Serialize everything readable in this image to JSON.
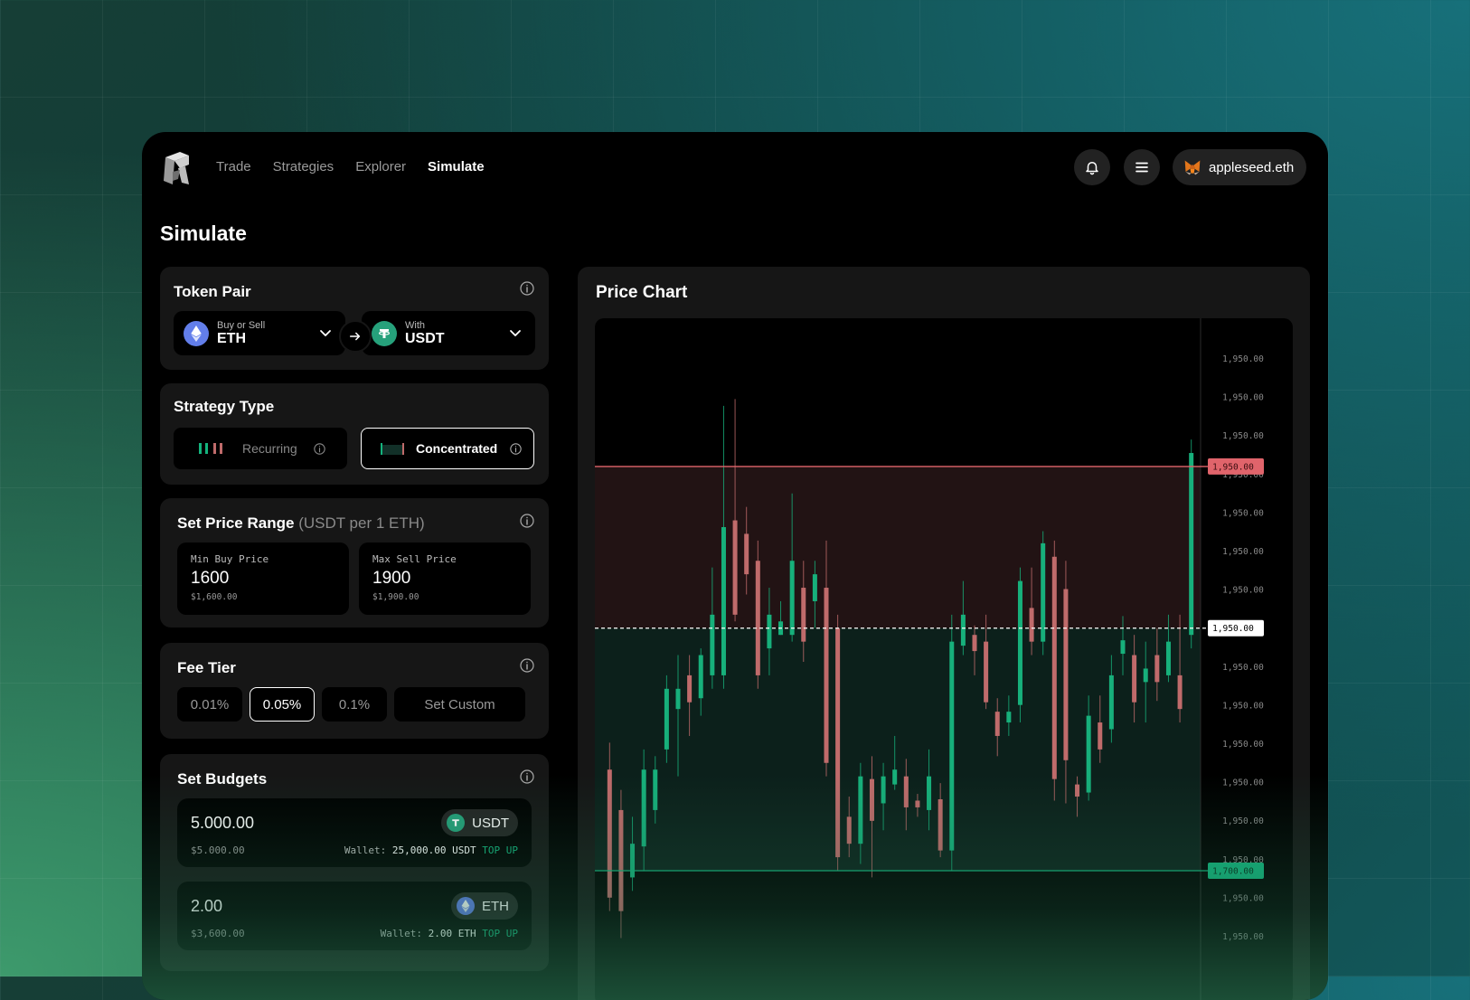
{
  "nav": {
    "items": [
      "Trade",
      "Strategies",
      "Explorer",
      "Simulate"
    ],
    "active": "Simulate"
  },
  "wallet": {
    "name": "appleseed.eth"
  },
  "page_title": "Simulate",
  "token_pair": {
    "title": "Token Pair",
    "base": {
      "label": "Buy or Sell",
      "symbol": "ETH"
    },
    "quote": {
      "label": "With",
      "symbol": "USDT"
    }
  },
  "strategy_type": {
    "title": "Strategy Type",
    "options": [
      "Recurring",
      "Concentrated"
    ],
    "selected": "Concentrated"
  },
  "price_range": {
    "title": "Set Price Range",
    "unit": "(USDT per 1 ETH)",
    "min": {
      "label": "Min Buy Price",
      "value": "1600",
      "usd": "$1,600.00"
    },
    "max": {
      "label": "Max Sell Price",
      "value": "1900",
      "usd": "$1,900.00"
    }
  },
  "fee_tier": {
    "title": "Fee Tier",
    "options": [
      "0.01%",
      "0.05%",
      "0.1%",
      "Set Custom"
    ],
    "selected": "0.05%"
  },
  "budgets": {
    "title": "Set Budgets",
    "items": [
      {
        "amount": "5.000.00",
        "usd": "$5.000.00",
        "token": "USDT",
        "wallet_label": "Wallet:",
        "wallet_value": "25,000.00 USDT",
        "action": "TOP UP"
      },
      {
        "amount": "2.00",
        "usd": "$3,600.00",
        "token": "ETH",
        "wallet_label": "Wallet:",
        "wallet_value": "2.00 ETH",
        "action": "TOP UP"
      }
    ]
  },
  "chart_data": {
    "type": "candlestick",
    "title": "Price Chart",
    "y_tick_labels": [
      "1,950.00",
      "1,950.00",
      "1,950.00",
      "1,950.00",
      "1,950.00",
      "1,950.00",
      "1,950.00",
      "1,950.00",
      "1,950.00",
      "1,950.00",
      "1,950.00",
      "1,950.00",
      "1,950.00",
      "1,950.00",
      "1,950.00",
      "1,950.00"
    ],
    "ylim": [
      1500,
      2010
    ],
    "sell_line": {
      "label": "1,950.00",
      "value": 1900
    },
    "current_line": {
      "label": "1,950.00",
      "value": 1780
    },
    "buy_line": {
      "label": "1,700.00",
      "value": 1600
    },
    "colors": {
      "up": "#17b07b",
      "down": "#c06b6b",
      "sell_zone": "#221314",
      "buy_zone": "#0c201b",
      "sell_line": "#e0646b",
      "buy_line": "#14b37d"
    },
    "candles": [
      {
        "o": 1675,
        "c": 1580,
        "h": 1695,
        "l": 1570
      },
      {
        "o": 1645,
        "c": 1570,
        "h": 1660,
        "l": 1550
      },
      {
        "o": 1595,
        "c": 1620,
        "h": 1640,
        "l": 1585
      },
      {
        "o": 1618,
        "c": 1675,
        "h": 1690,
        "l": 1600
      },
      {
        "o": 1645,
        "c": 1675,
        "h": 1685,
        "l": 1635
      },
      {
        "o": 1690,
        "c": 1735,
        "h": 1745,
        "l": 1680
      },
      {
        "o": 1720,
        "c": 1735,
        "h": 1760,
        "l": 1670
      },
      {
        "o": 1745,
        "c": 1725,
        "h": 1760,
        "l": 1700
      },
      {
        "o": 1728,
        "c": 1760,
        "h": 1765,
        "l": 1715
      },
      {
        "o": 1745,
        "c": 1790,
        "h": 1825,
        "l": 1735
      },
      {
        "o": 1745,
        "c": 1855,
        "h": 1945,
        "l": 1735
      },
      {
        "o": 1860,
        "c": 1790,
        "h": 1950,
        "l": 1785
      },
      {
        "o": 1850,
        "c": 1820,
        "h": 1870,
        "l": 1805
      },
      {
        "o": 1830,
        "c": 1745,
        "h": 1845,
        "l": 1735
      },
      {
        "o": 1765,
        "c": 1790,
        "h": 1810,
        "l": 1745
      },
      {
        "o": 1775,
        "c": 1785,
        "h": 1800,
        "l": 1775
      },
      {
        "o": 1775,
        "c": 1830,
        "h": 1880,
        "l": 1770
      },
      {
        "o": 1810,
        "c": 1770,
        "h": 1830,
        "l": 1755
      },
      {
        "o": 1800,
        "c": 1820,
        "h": 1830,
        "l": 1780
      },
      {
        "o": 1810,
        "c": 1680,
        "h": 1845,
        "l": 1670
      },
      {
        "o": 1780,
        "c": 1610,
        "h": 1790,
        "l": 1600
      },
      {
        "o": 1640,
        "c": 1620,
        "h": 1655,
        "l": 1610
      },
      {
        "o": 1620,
        "c": 1670,
        "h": 1680,
        "l": 1605
      },
      {
        "o": 1668,
        "c": 1637,
        "h": 1685,
        "l": 1595
      },
      {
        "o": 1650,
        "c": 1670,
        "h": 1680,
        "l": 1630
      },
      {
        "o": 1664,
        "c": 1675,
        "h": 1700,
        "l": 1660
      },
      {
        "o": 1670,
        "c": 1647,
        "h": 1683,
        "l": 1630
      },
      {
        "o": 1652,
        "c": 1647,
        "h": 1657,
        "l": 1640
      },
      {
        "o": 1645,
        "c": 1670,
        "h": 1690,
        "l": 1630
      },
      {
        "o": 1653,
        "c": 1615,
        "h": 1665,
        "l": 1610
      },
      {
        "o": 1615,
        "c": 1770,
        "h": 1790,
        "l": 1600
      },
      {
        "o": 1767,
        "c": 1790,
        "h": 1815,
        "l": 1760
      },
      {
        "o": 1775,
        "c": 1763,
        "h": 1782,
        "l": 1745
      },
      {
        "o": 1770,
        "c": 1725,
        "h": 1790,
        "l": 1720
      },
      {
        "o": 1718,
        "c": 1700,
        "h": 1728,
        "l": 1685
      },
      {
        "o": 1710,
        "c": 1718,
        "h": 1730,
        "l": 1700
      },
      {
        "o": 1723,
        "c": 1815,
        "h": 1825,
        "l": 1710
      },
      {
        "o": 1795,
        "c": 1770,
        "h": 1825,
        "l": 1760
      },
      {
        "o": 1770,
        "c": 1843,
        "h": 1852,
        "l": 1760
      },
      {
        "o": 1833,
        "c": 1668,
        "h": 1845,
        "l": 1652
      },
      {
        "o": 1809,
        "c": 1682,
        "h": 1830,
        "l": 1650
      },
      {
        "o": 1664,
        "c": 1655,
        "h": 1670,
        "l": 1640
      },
      {
        "o": 1658,
        "c": 1715,
        "h": 1730,
        "l": 1652
      },
      {
        "o": 1710,
        "c": 1690,
        "h": 1730,
        "l": 1680
      },
      {
        "o": 1705,
        "c": 1745,
        "h": 1760,
        "l": 1695
      },
      {
        "o": 1761,
        "c": 1771,
        "h": 1789,
        "l": 1745
      },
      {
        "o": 1760,
        "c": 1725,
        "h": 1775,
        "l": 1710
      },
      {
        "o": 1740,
        "c": 1750,
        "h": 1770,
        "l": 1710
      },
      {
        "o": 1760,
        "c": 1740,
        "h": 1780,
        "l": 1726
      },
      {
        "o": 1745,
        "c": 1770,
        "h": 1790,
        "l": 1740
      },
      {
        "o": 1745,
        "c": 1720,
        "h": 1790,
        "l": 1710
      },
      {
        "o": 1775,
        "c": 1910,
        "h": 1920,
        "l": 1765
      }
    ]
  }
}
